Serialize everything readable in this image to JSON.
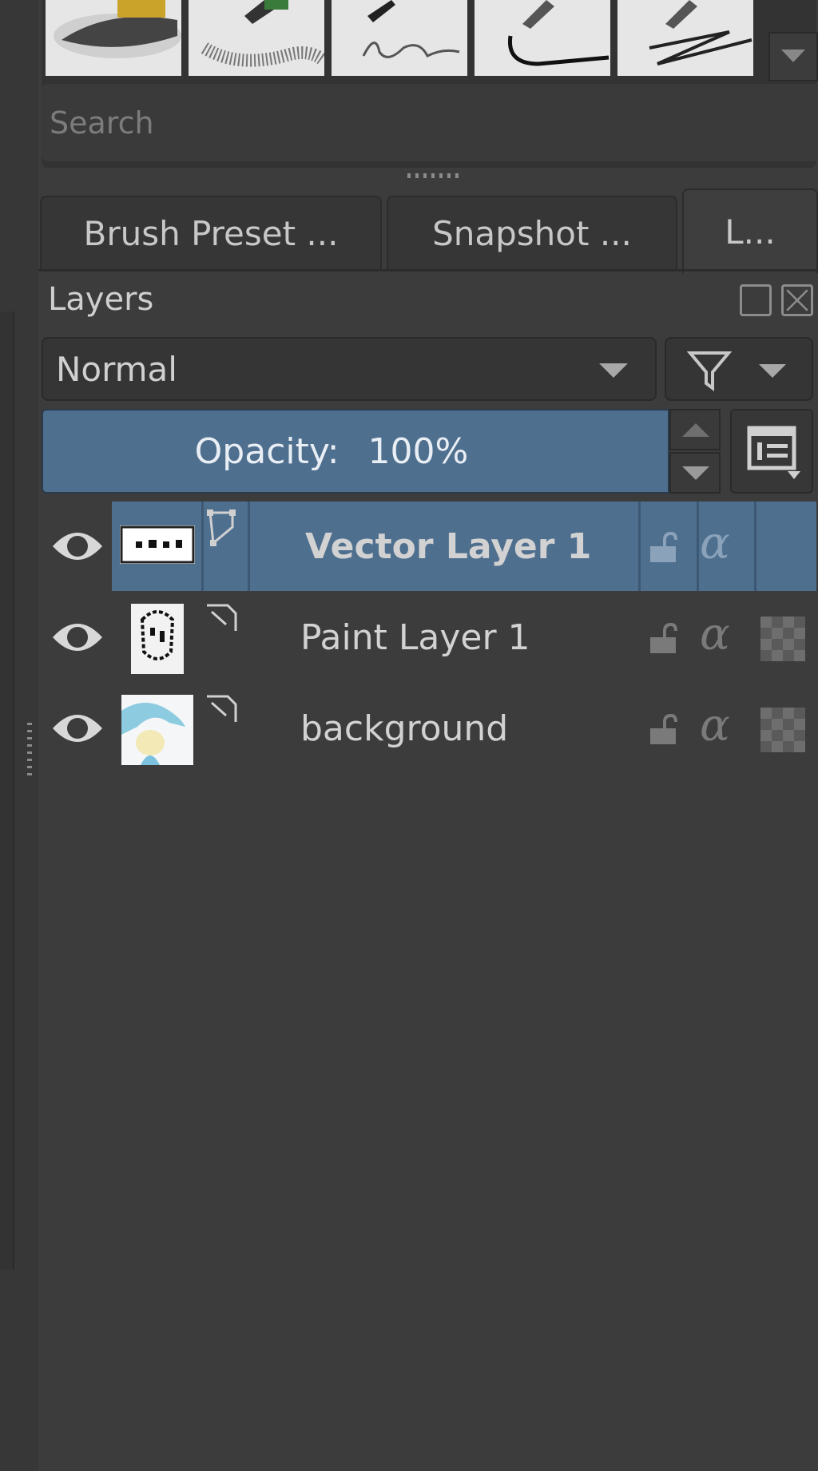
{
  "search": {
    "placeholder": "Search"
  },
  "tabs": [
    {
      "label": "Brush Preset ...",
      "active": false
    },
    {
      "label": "Snapshot ...",
      "active": false
    },
    {
      "label": "L...",
      "active": true
    }
  ],
  "docker": {
    "title": "Layers"
  },
  "blend_mode": {
    "value": "Normal"
  },
  "opacity": {
    "label": "Opacity:",
    "value": "100%"
  },
  "layers": [
    {
      "name": "Vector Layer 1",
      "type": "vector",
      "visible": true,
      "selected": true
    },
    {
      "name": "Paint Layer 1",
      "type": "paint",
      "visible": true,
      "selected": false
    },
    {
      "name": "background",
      "type": "paint",
      "visible": true,
      "selected": false
    }
  ],
  "colors": {
    "selection": "#4f6f8f",
    "panel": "#3c3c3c"
  }
}
